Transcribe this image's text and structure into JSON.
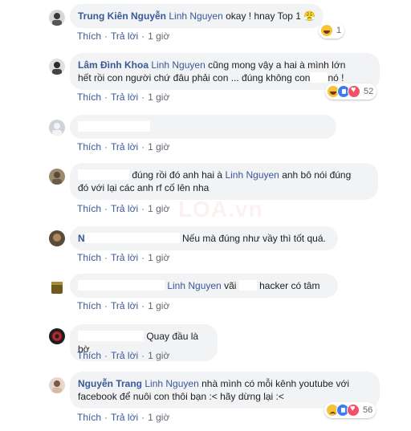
{
  "actions": {
    "like": "Thích",
    "reply": "Trả lời",
    "time": "1 giờ"
  },
  "comments": [
    {
      "author": "Trung Kiên Nguyễn",
      "mention": "Linh Nguyen",
      "text": "okay ! hnay Top 1 😤",
      "reaction_count": "1"
    },
    {
      "author": "Lâm Đình Khoa",
      "mention": "Linh Nguyen",
      "text": "cũng mong vậy a hai à mình lớn",
      "text2": "hết rồi con người chứ đâu phải con ... đúng không con",
      "text2_end": "nó !",
      "reaction_count": "52"
    },
    {
      "text": ""
    },
    {
      "text_before": "đúng rồi đó anh hai à",
      "mention": "Linh Nguyen",
      "text_after": "anh bô nói đúng",
      "text2": "đó với lại các anh rf cố lên nha"
    },
    {
      "author_initial": "N",
      "text": "Nếu mà đúng như vầy thì tốt quá."
    },
    {
      "mention": "Linh Nguyen",
      "text_mid": "vãi",
      "text_end": "hacker có tâm"
    },
    {
      "text": "Quay đầu là bờ"
    },
    {
      "author": "Nguyễn Trang",
      "mention": "Linh Nguyen",
      "text": "nhà mình có mỗi kênh youtube với",
      "text2": "facebook để nuôi con thôi bạn :< hãy dừng lại :<",
      "reaction_count": "56"
    }
  ],
  "watermark": "LOA.vn",
  "colors": {
    "link": "#385898",
    "bubble": "#f2f3f5",
    "meta": "#606770"
  }
}
